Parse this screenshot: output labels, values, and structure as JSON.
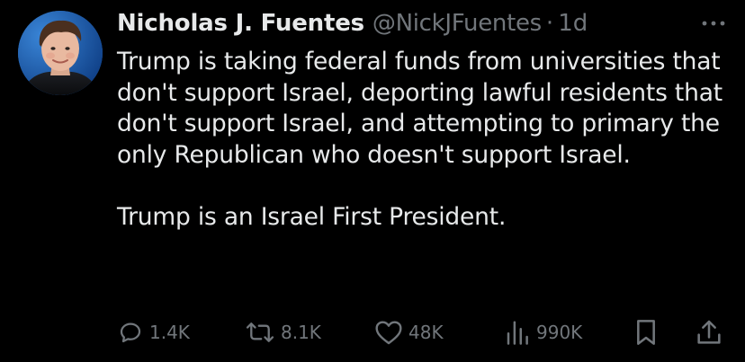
{
  "tweet": {
    "author": {
      "display_name": "Nicholas J. Fuentes",
      "handle": "@NickJFuentes",
      "separator": "·",
      "time": "1d",
      "avatar_icon": "profile-photo"
    },
    "body": {
      "paragraph_1": "Trump is taking federal funds from universities that don't support Israel, deporting lawful residents that don't support Israel, and attempting to primary the only Republican who doesn't support Israel.",
      "paragraph_2": "Trump is an Israel First President."
    },
    "actions": {
      "reply": {
        "icon": "reply-icon",
        "count": "1.4K"
      },
      "retweet": {
        "icon": "retweet-icon",
        "count": "8.1K"
      },
      "like": {
        "icon": "heart-icon",
        "count": "48K"
      },
      "views": {
        "icon": "views-icon",
        "count": "990K"
      },
      "bookmark": {
        "icon": "bookmark-icon"
      },
      "share": {
        "icon": "share-icon"
      }
    }
  },
  "colors": {
    "background": "#000000",
    "primary_text": "#e7e9ea",
    "secondary_text": "#71767b"
  }
}
